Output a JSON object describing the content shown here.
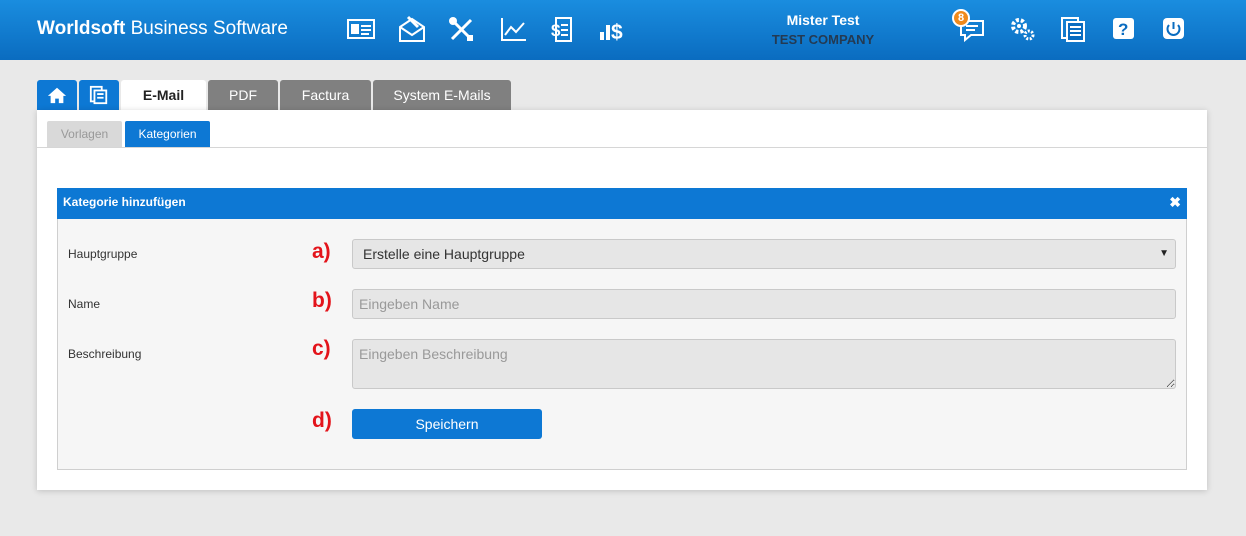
{
  "header": {
    "brand_bold": "Worldsoft",
    "brand_rest": " Business Software",
    "user_name": "Mister Test",
    "company": "TEST COMPANY",
    "notification_count": "8"
  },
  "tabs": [
    {
      "label": "E-Mail"
    },
    {
      "label": "PDF"
    },
    {
      "label": "Factura"
    },
    {
      "label": "System E-Mails"
    }
  ],
  "subtabs": [
    {
      "label": "Vorlagen"
    },
    {
      "label": "Kategorien"
    }
  ],
  "dialog": {
    "title": "Kategorie hinzufügen",
    "close_glyph": "✖",
    "fields": {
      "hauptgruppe": {
        "label": "Hauptgruppe",
        "marker": "a)",
        "value": "Erstelle eine Hauptgruppe"
      },
      "name": {
        "label": "Name",
        "marker": "b)",
        "placeholder": "Eingeben Name"
      },
      "beschreibung": {
        "label": "Beschreibung",
        "marker": "c)",
        "placeholder": "Eingeben Beschreibung"
      }
    },
    "save_marker": "d)",
    "save_label": "Speichern"
  },
  "colors": {
    "header_blue": "#0a6cc0",
    "accent_blue": "#0d78d4",
    "marker_red": "#e3141b",
    "badge_orange": "#f08a1c"
  }
}
